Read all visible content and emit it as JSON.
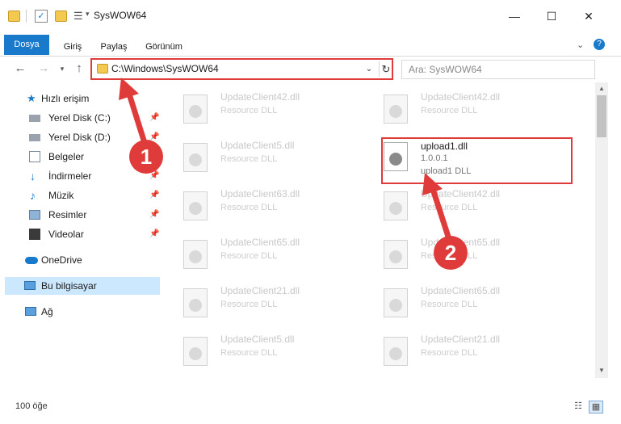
{
  "window": {
    "title": "SysWOW64"
  },
  "ribbon": {
    "tabs": [
      "Dosya",
      "Giriş",
      "Paylaş",
      "Görünüm"
    ]
  },
  "address": {
    "path": "C:\\Windows\\SysWOW64"
  },
  "search": {
    "placeholder": "Ara: SysWOW64"
  },
  "sidebar": {
    "quick_access": "Hızlı erişim",
    "items": [
      "Yerel Disk (C:)",
      "Yerel Disk (D:)",
      "Belgeler",
      "İndirmeler",
      "Müzik",
      "Resimler",
      "Videolar"
    ],
    "onedrive": "OneDrive",
    "this_pc": "Bu bilgisayar",
    "network": "Ağ"
  },
  "files": {
    "left": [
      {
        "name": "UpdateClient42.dll",
        "desc": "Resource DLL"
      },
      {
        "name": "UpdateClient5.dll",
        "desc": "Resource DLL"
      },
      {
        "name": "UpdateClient63.dll",
        "desc": "Resource DLL"
      },
      {
        "name": "UpdateClient65.dll",
        "desc": "Resource DLL"
      },
      {
        "name": "UpdateClient21.dll",
        "desc": "Resource DLL"
      },
      {
        "name": "UpdateClient5.dll",
        "desc": "Resource DLL"
      }
    ],
    "right": [
      {
        "name": "UpdateClient42.dll",
        "desc": "Resource DLL"
      },
      {
        "name": "UpdateClient42.dll",
        "desc": "Resource DLL"
      },
      {
        "name": "UpdateClient65.dll",
        "desc": "Resource DLL"
      },
      {
        "name": "UpdateClient65.dll",
        "desc": "Resource DLL"
      },
      {
        "name": "UpdateClient21.dll",
        "desc": "Resource DLL"
      }
    ],
    "highlighted": {
      "name": "upload1.dll",
      "version": "1.0.0.1",
      "desc": "upload1 DLL"
    }
  },
  "status": {
    "count": "100 öğe"
  },
  "annotations": {
    "step1": "1",
    "step2": "2",
    "color": "#e03b3b"
  }
}
